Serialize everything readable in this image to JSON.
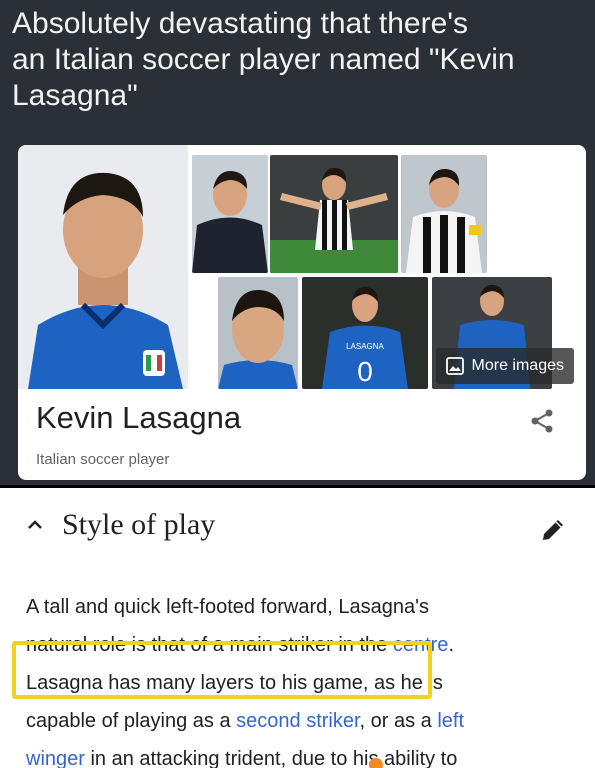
{
  "meme": {
    "caption_line1": "Absolutely devastating that there's",
    "caption_line2": "an Italian soccer player named \"Kevin",
    "caption_line3": "Lasagna\""
  },
  "knowledge_panel": {
    "more_images_label": "More images",
    "name": "Kevin Lasagna",
    "subtitle": "Italian soccer player",
    "icons": [
      "image-icon",
      "share-icon"
    ]
  },
  "wiki_section": {
    "title": "Style of play",
    "line1": "A tall and quick left-footed forward, Lasagna's",
    "line2_prefix": "natural role is that of a main striker in the ",
    "line2_link": "centre",
    "line2_suffix": ".",
    "line3_highlighted": "Lasagna has many layers to his game,",
    "line3_rest": " as he is",
    "line4_prefix": "capable of playing as a ",
    "line4_link1": "second striker",
    "line4_mid": ", or as a ",
    "line4_link2": "left",
    "line5_link": "winger",
    "line5_rest": " in an attacking trident, due to his ability to",
    "icons": [
      "chevron-up-icon",
      "pencil-icon"
    ]
  },
  "colors": {
    "background": "#2b2f36",
    "link": "#3366cc",
    "highlight": "#f3d11e",
    "jersey_blue": "#1f63c2"
  }
}
